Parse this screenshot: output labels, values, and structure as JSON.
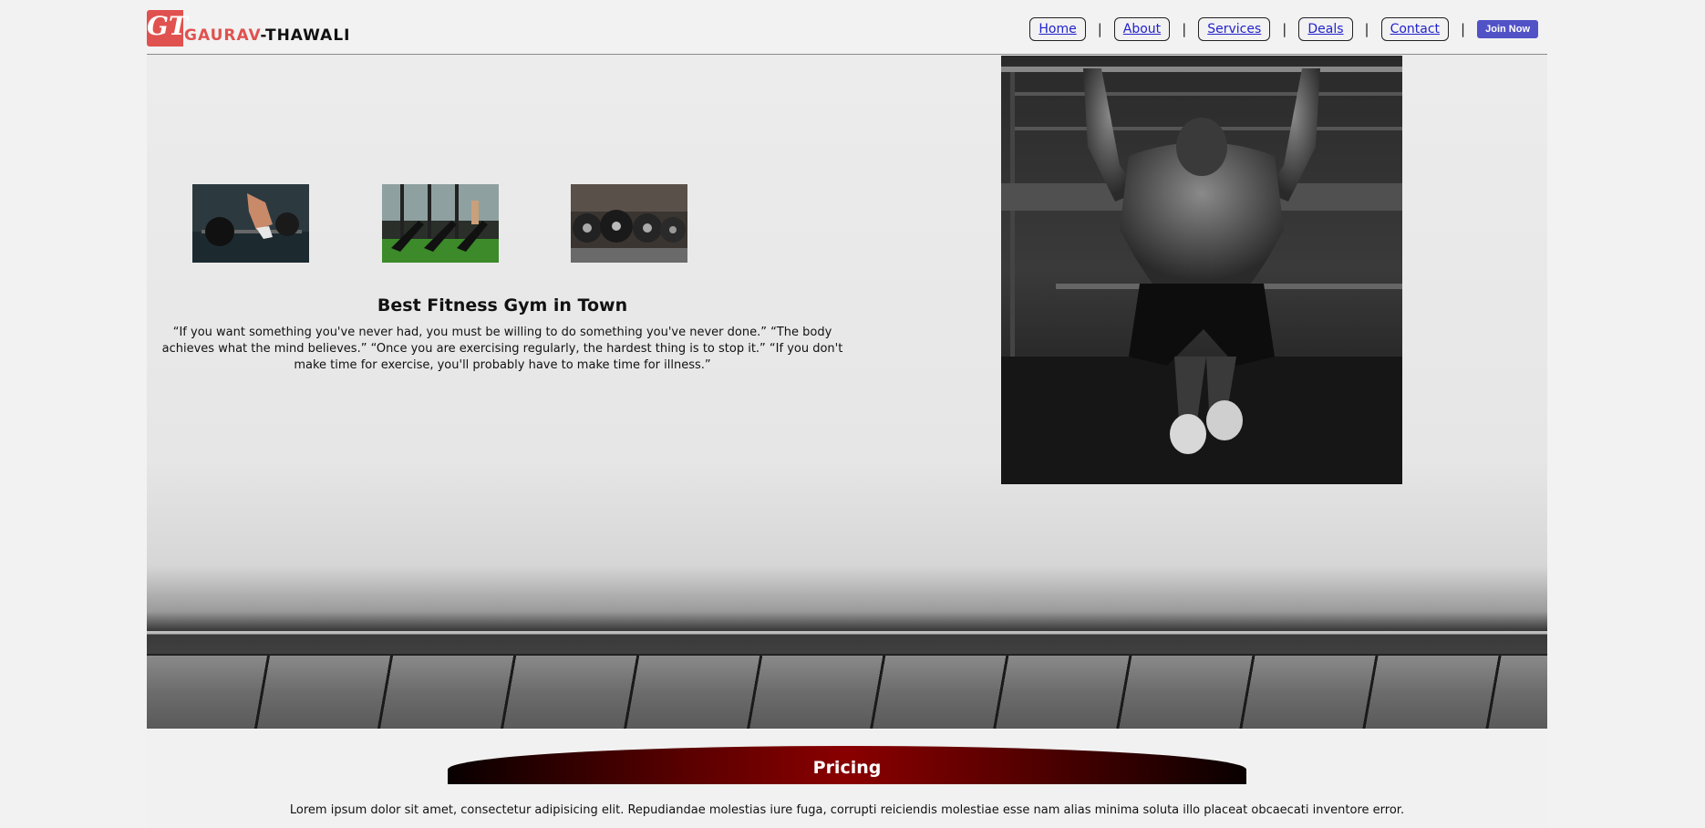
{
  "brand": {
    "badge": "GT",
    "first": "GAURAV",
    "separator": "-",
    "last": "THAWALI",
    "accent_color": "#e0524f"
  },
  "nav": {
    "items": [
      {
        "label": "Home"
      },
      {
        "label": "About"
      },
      {
        "label": "Services"
      },
      {
        "label": "Deals"
      },
      {
        "label": "Contact"
      }
    ],
    "separator": "|",
    "join_label": "Join Now",
    "join_color": "#5252c7"
  },
  "hero": {
    "title": "Best Fitness Gym in Town",
    "quote": "“If you want something you've never had, you must be willing to do something you've never done.” “The body achieves what the mind believes.” “Once you are exercising regularly, the hardest thing is to stop it.” “If you don't make time for exercise, you'll probably have to make time for illness.”",
    "thumbnails": [
      {
        "icon": "barbell-lift-photo"
      },
      {
        "icon": "treadmills-photo"
      },
      {
        "icon": "weight-plates-photo"
      }
    ],
    "main_photo": "pull-up-athlete-photo"
  },
  "pricing": {
    "title": "Pricing",
    "text": "Lorem ipsum dolor sit amet, consectetur adipisicing elit. Repudiandae molestias iure fuga, corrupti reiciendis molestiae esse nam alias minima soluta illo placeat obcaecati inventore error.",
    "bar_color": "#8a0000"
  }
}
